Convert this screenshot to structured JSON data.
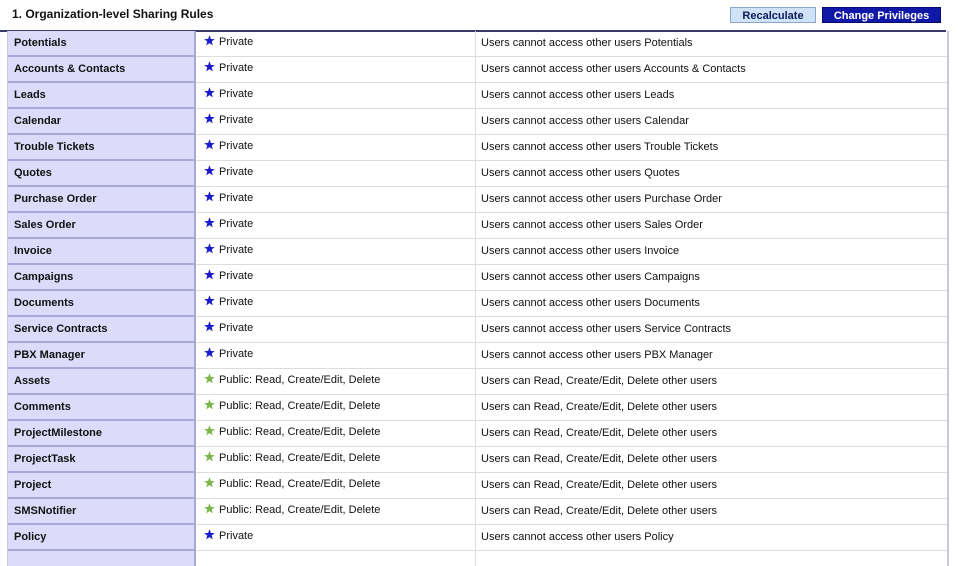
{
  "header": {
    "title": "1. Organization-level Sharing Rules",
    "recalculate_label": "Recalculate",
    "change_privileges_label": "Change Privileges"
  },
  "colors": {
    "private_star": "#1a1acc",
    "public_star": "#7ab648",
    "module_cell_bg": "#dcdcfa",
    "change_button_bg": "#1018a8",
    "recalculate_button_bg": "#cfe2f7"
  },
  "rows": [
    {
      "module": "Potentials",
      "access": "Private",
      "icon": "private-star-icon",
      "description": "Users cannot access other users Potentials"
    },
    {
      "module": "Accounts & Contacts",
      "access": "Private",
      "icon": "private-star-icon",
      "description": "Users cannot access other users Accounts & Contacts"
    },
    {
      "module": "Leads",
      "access": "Private",
      "icon": "private-star-icon",
      "description": "Users cannot access other users Leads"
    },
    {
      "module": "Calendar",
      "access": "Private",
      "icon": "private-star-icon",
      "description": "Users cannot access other users Calendar"
    },
    {
      "module": "Trouble Tickets",
      "access": "Private",
      "icon": "private-star-icon",
      "description": "Users cannot access other users Trouble Tickets"
    },
    {
      "module": "Quotes",
      "access": "Private",
      "icon": "private-star-icon",
      "description": "Users cannot access other users Quotes"
    },
    {
      "module": "Purchase Order",
      "access": "Private",
      "icon": "private-star-icon",
      "description": "Users cannot access other users Purchase Order"
    },
    {
      "module": "Sales Order",
      "access": "Private",
      "icon": "private-star-icon",
      "description": "Users cannot access other users Sales Order"
    },
    {
      "module": "Invoice",
      "access": "Private",
      "icon": "private-star-icon",
      "description": "Users cannot access other users Invoice"
    },
    {
      "module": "Campaigns",
      "access": "Private",
      "icon": "private-star-icon",
      "description": "Users cannot access other users Campaigns"
    },
    {
      "module": "Documents",
      "access": "Private",
      "icon": "private-star-icon",
      "description": "Users cannot access other users Documents"
    },
    {
      "module": "Service Contracts",
      "access": "Private",
      "icon": "private-star-icon",
      "description": "Users cannot access other users Service Contracts"
    },
    {
      "module": "PBX Manager",
      "access": "Private",
      "icon": "private-star-icon",
      "description": "Users cannot access other users PBX Manager"
    },
    {
      "module": "Assets",
      "access": "Public: Read, Create/Edit, Delete",
      "icon": "public-star-icon",
      "description": "Users can Read, Create/Edit, Delete other users"
    },
    {
      "module": "Comments",
      "access": "Public: Read, Create/Edit, Delete",
      "icon": "public-star-icon",
      "description": "Users can Read, Create/Edit, Delete other users"
    },
    {
      "module": "ProjectMilestone",
      "access": "Public: Read, Create/Edit, Delete",
      "icon": "public-star-icon",
      "description": "Users can Read, Create/Edit, Delete other users"
    },
    {
      "module": "ProjectTask",
      "access": "Public: Read, Create/Edit, Delete",
      "icon": "public-star-icon",
      "description": "Users can Read, Create/Edit, Delete other users"
    },
    {
      "module": "Project",
      "access": "Public: Read, Create/Edit, Delete",
      "icon": "public-star-icon",
      "description": "Users can Read, Create/Edit, Delete other users"
    },
    {
      "module": "SMSNotifier",
      "access": "Public: Read, Create/Edit, Delete",
      "icon": "public-star-icon",
      "description": "Users can Read, Create/Edit, Delete other users"
    },
    {
      "module": "Policy",
      "access": "Private",
      "icon": "private-star-icon",
      "description": "Users cannot access other users Policy"
    }
  ]
}
